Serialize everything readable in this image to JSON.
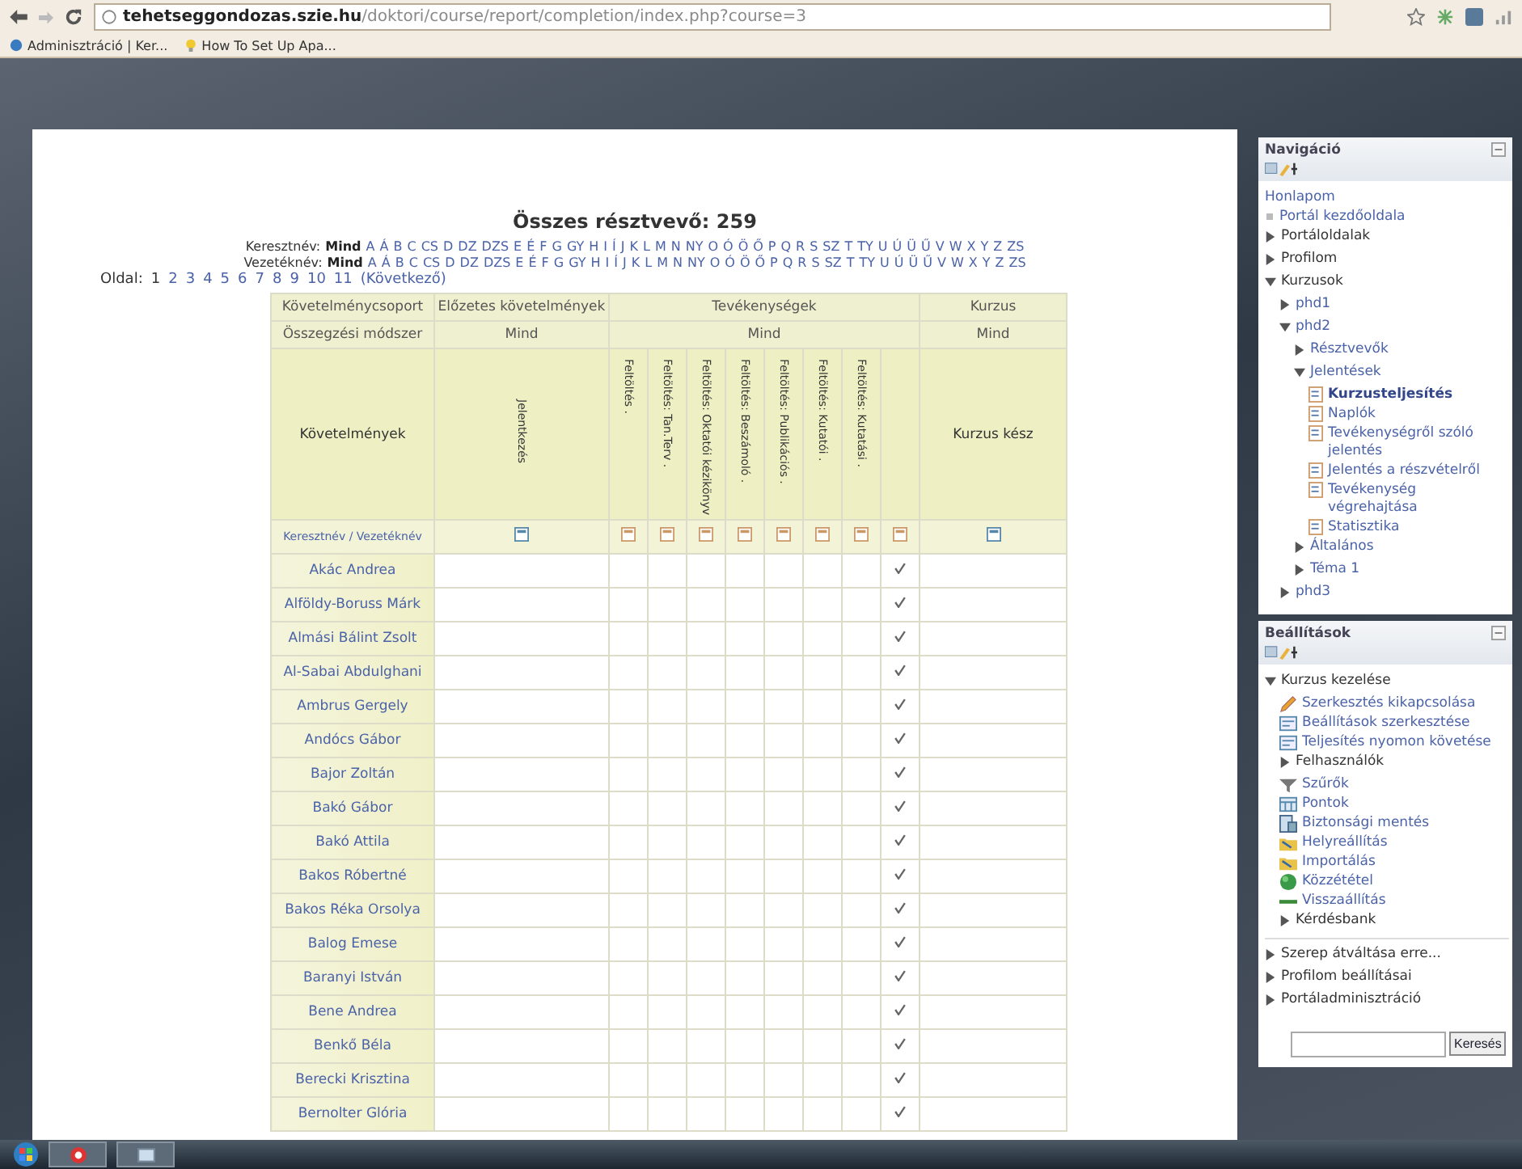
{
  "browser": {
    "domain": "tehetseggondozas.szie.hu",
    "path": "/doktori/course/report/completion/index.php?course=3",
    "bookmarks": [
      "Adminisztráció | Ker...",
      "How To Set Up Apa..."
    ]
  },
  "report": {
    "title": "Összes résztvevő: 259",
    "filters": [
      {
        "label": "Keresztnév:",
        "all": "Mind",
        "letters": [
          "A",
          "Á",
          "B",
          "C",
          "CS",
          "D",
          "DZ",
          "DZS",
          "E",
          "É",
          "F",
          "G",
          "GY",
          "H",
          "I",
          "Í",
          "J",
          "K",
          "L",
          "M",
          "N",
          "NY",
          "O",
          "Ó",
          "Ö",
          "Ő",
          "P",
          "Q",
          "R",
          "S",
          "SZ",
          "T",
          "TY",
          "U",
          "Ú",
          "Ü",
          "Ű",
          "V",
          "W",
          "X",
          "Y",
          "Z",
          "ZS"
        ]
      },
      {
        "label": "Vezetéknév:",
        "all": "Mind",
        "letters": [
          "A",
          "Á",
          "B",
          "C",
          "CS",
          "D",
          "DZ",
          "DZS",
          "E",
          "É",
          "F",
          "G",
          "GY",
          "H",
          "I",
          "Í",
          "J",
          "K",
          "L",
          "M",
          "N",
          "NY",
          "O",
          "Ó",
          "Ö",
          "Ő",
          "P",
          "Q",
          "R",
          "S",
          "SZ",
          "T",
          "TY",
          "U",
          "Ú",
          "Ü",
          "Ű",
          "V",
          "W",
          "X",
          "Y",
          "Z",
          "ZS"
        ]
      }
    ],
    "pager": {
      "label": "Oldal:",
      "pages": [
        {
          "label": "1",
          "selected": true
        },
        {
          "label": "2",
          "selected": false
        },
        {
          "label": "3",
          "selected": false
        },
        {
          "label": "4",
          "selected": false
        },
        {
          "label": "5",
          "selected": false
        },
        {
          "label": "6",
          "selected": false
        },
        {
          "label": "7",
          "selected": false
        },
        {
          "label": "8",
          "selected": false
        },
        {
          "label": "9",
          "selected": false
        },
        {
          "label": "10",
          "selected": false
        },
        {
          "label": "11",
          "selected": false
        }
      ],
      "next": "(Következő)"
    },
    "table": {
      "group_row": [
        "Követelménycsoport",
        "Előzetes követelmények",
        "Tevékenységek",
        "Kurzus"
      ],
      "method_row": [
        "Összegzési módszer",
        "Mind",
        "Mind",
        "Mind"
      ],
      "criteria_label": "Követelmények",
      "prerequisite": "Jelentkezés",
      "activities": [
        {
          "label": "Feltöltés ."
        },
        {
          "label": "Feltöltés: Tan.Terv ."
        },
        {
          "label": "Feltöltés: Oktatói kézikönyv"
        },
        {
          "label": "Feltöltés: Beszámoló ."
        },
        {
          "label": "Feltöltés: Publikációs ."
        },
        {
          "label": "Feltöltés: Kutatói ."
        },
        {
          "label": "Feltöltés: Kutatási ."
        }
      ],
      "course_label": "Kurzus kész",
      "sort_link": "Keresztnév / Vezetéknév",
      "rows": [
        {
          "name": "Akác Andrea",
          "done": true
        },
        {
          "name": "Alföldy-Boruss Márk",
          "done": true
        },
        {
          "name": "Almási Bálint Zsolt",
          "done": true
        },
        {
          "name": "Al-Sabai Abdulghani",
          "done": true
        },
        {
          "name": "Ambrus Gergely",
          "done": true
        },
        {
          "name": "Andócs Gábor",
          "done": true
        },
        {
          "name": "Bajor Zoltán",
          "done": true
        },
        {
          "name": "Bakó Gábor",
          "done": true
        },
        {
          "name": "Bakó Attila",
          "done": true
        },
        {
          "name": "Bakos Róbertné",
          "done": true
        },
        {
          "name": "Bakos Réka Orsolya",
          "done": true
        },
        {
          "name": "Balog Emese",
          "done": true
        },
        {
          "name": "Baranyi István",
          "done": true
        },
        {
          "name": "Bene Andrea",
          "done": true
        },
        {
          "name": "Benkő Béla",
          "done": true
        },
        {
          "name": "Berecki Krisztina",
          "done": true
        },
        {
          "name": "Bernolter Glória",
          "done": true
        }
      ]
    }
  },
  "navigation": {
    "title": "Navigáció",
    "items": [
      {
        "label": "Honlapom",
        "kind": "home"
      },
      {
        "label": "Portál kezdőoldala",
        "kind": "bullet"
      },
      {
        "label": "Portáloldalak",
        "kind": "branch",
        "expanded": false
      },
      {
        "label": "Profilom",
        "kind": "branch",
        "expanded": false
      },
      {
        "label": "Kurzusok",
        "kind": "branch",
        "expanded": true,
        "children": [
          {
            "label": "phd1",
            "kind": "branch",
            "expanded": false
          },
          {
            "label": "phd2",
            "kind": "branch",
            "expanded": true,
            "children": [
              {
                "label": "Résztvevők",
                "kind": "branch",
                "expanded": false
              },
              {
                "label": "Jelentések",
                "kind": "branch",
                "expanded": true,
                "children": [
                  {
                    "label": "Kurzusteljesítés",
                    "kind": "report",
                    "selected": true
                  },
                  {
                    "label": "Naplók",
                    "kind": "report",
                    "selected": false
                  },
                  {
                    "label": "Tevékenységről szóló jelentés",
                    "kind": "report",
                    "selected": false
                  },
                  {
                    "label": "Jelentés a részvételről",
                    "kind": "report",
                    "selected": false
                  },
                  {
                    "label": "Tevékenység végrehajtása",
                    "kind": "report",
                    "selected": false
                  },
                  {
                    "label": "Statisztika",
                    "kind": "report",
                    "selected": false
                  }
                ]
              },
              {
                "label": "Általános",
                "kind": "branch",
                "expanded": false
              },
              {
                "label": "Téma 1",
                "kind": "branch",
                "expanded": false
              }
            ]
          },
          {
            "label": "phd3",
            "kind": "branch",
            "expanded": false
          }
        ]
      }
    ]
  },
  "settings": {
    "title": "Beállítások",
    "items": [
      {
        "label": "Kurzus kezelése",
        "kind": "branch",
        "expanded": true,
        "children": [
          {
            "label": "Szerkesztés kikapcsolása",
            "kind": "pencil"
          },
          {
            "label": "Beállítások szerkesztése",
            "kind": "form"
          },
          {
            "label": "Teljesítés nyomon követése",
            "kind": "form"
          },
          {
            "label": "Felhasználók",
            "kind": "branch",
            "expanded": false
          },
          {
            "label": "Szűrők",
            "kind": "filter"
          },
          {
            "label": "Pontok",
            "kind": "grid"
          },
          {
            "label": "Biztonsági mentés",
            "kind": "backup"
          },
          {
            "label": "Helyreállítás",
            "kind": "folder"
          },
          {
            "label": "Importálás",
            "kind": "folder"
          },
          {
            "label": "Közzététel",
            "kind": "globe"
          },
          {
            "label": "Visszaállítás",
            "kind": "reset"
          },
          {
            "label": "Kérdésbank",
            "kind": "branch",
            "expanded": false
          }
        ]
      },
      {
        "label": "Szerep átváltása erre...",
        "kind": "branch",
        "expanded": false
      },
      {
        "label": "Profilom beállításai",
        "kind": "branch",
        "expanded": false
      },
      {
        "label": "Portáladminisztráció",
        "kind": "branch",
        "expanded": false
      }
    ],
    "search_button": "Keresés"
  }
}
